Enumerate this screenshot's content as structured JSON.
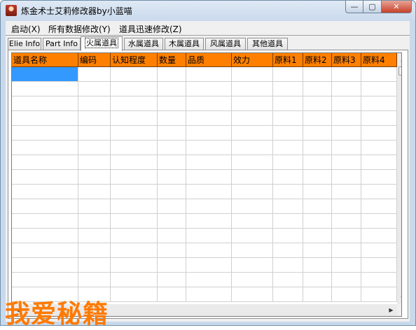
{
  "window": {
    "title": "炼金术士艾莉修改器by小蓝喵",
    "min_icon": "minimize-icon",
    "max_icon": "maximize-icon",
    "close_icon": "close-icon"
  },
  "menu": [
    "启动(X)",
    "所有数据修改(Y)",
    "道具迅速修改(Z)"
  ],
  "tabs": [
    {
      "label": "Elie Info"
    },
    {
      "label": "Part Info"
    },
    {
      "label": "火属道具",
      "active": true
    },
    {
      "label": "水属道具"
    },
    {
      "label": "木属道具"
    },
    {
      "label": "风属道具"
    },
    {
      "label": "其他道具"
    }
  ],
  "grid": {
    "header_color": "#ff8000",
    "selection_color": "#3399ff",
    "columns": [
      "道具名称",
      "编码",
      "认知程度",
      "数量",
      "品质",
      "效力",
      "原料1",
      "原料2",
      "原料3",
      "原料4"
    ],
    "row_count": 16
  },
  "watermark": "我爱秘籍"
}
